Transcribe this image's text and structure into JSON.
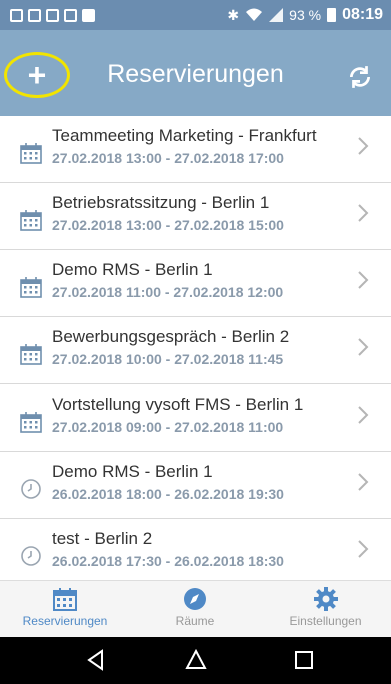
{
  "status_bar": {
    "icons": [
      "image-notification-icon",
      "mail-icon",
      "mail-icon",
      "mail-icon",
      "photo-icon"
    ],
    "battery": "93 %",
    "time": "08:19"
  },
  "header": {
    "title": "Reservierungen",
    "add_button_symbol": "+"
  },
  "reservations": [
    {
      "title": "Teammeeting Marketing - Frankfurt",
      "time": "27.02.2018 13:00 - 27.02.2018 17:00",
      "icon": "calendar-icon"
    },
    {
      "title": "Betriebsratssitzung - Berlin 1",
      "time": "27.02.2018 13:00 - 27.02.2018 15:00",
      "icon": "calendar-icon"
    },
    {
      "title": "Demo RMS - Berlin 1",
      "time": "27.02.2018 11:00 - 27.02.2018 12:00",
      "icon": "calendar-icon"
    },
    {
      "title": "Bewerbungsgespräch - Berlin 2",
      "time": "27.02.2018 10:00 - 27.02.2018 11:45",
      "icon": "calendar-icon"
    },
    {
      "title": "Vortstellung vysoft FMS - Berlin 1",
      "time": "27.02.2018 09:00 - 27.02.2018 11:00",
      "icon": "calendar-icon"
    },
    {
      "title": "Demo RMS - Berlin 1",
      "time": "26.02.2018 18:00 - 26.02.2018 19:30",
      "icon": "clock-icon"
    },
    {
      "title": "test - Berlin 2",
      "time": "26.02.2018 17:30 - 26.02.2018 18:30",
      "icon": "clock-icon"
    }
  ],
  "tabs": [
    {
      "label": "Reservierungen",
      "icon": "calendar-icon",
      "active": true
    },
    {
      "label": "Räume",
      "icon": "compass-icon",
      "active": false
    },
    {
      "label": "Einstellungen",
      "icon": "gear-icon",
      "active": false
    }
  ],
  "colors": {
    "header": "#86a9c6",
    "status_bar": "#6b8db0",
    "accent": "#4f89c6",
    "highlight_ring": "#f2e400"
  }
}
